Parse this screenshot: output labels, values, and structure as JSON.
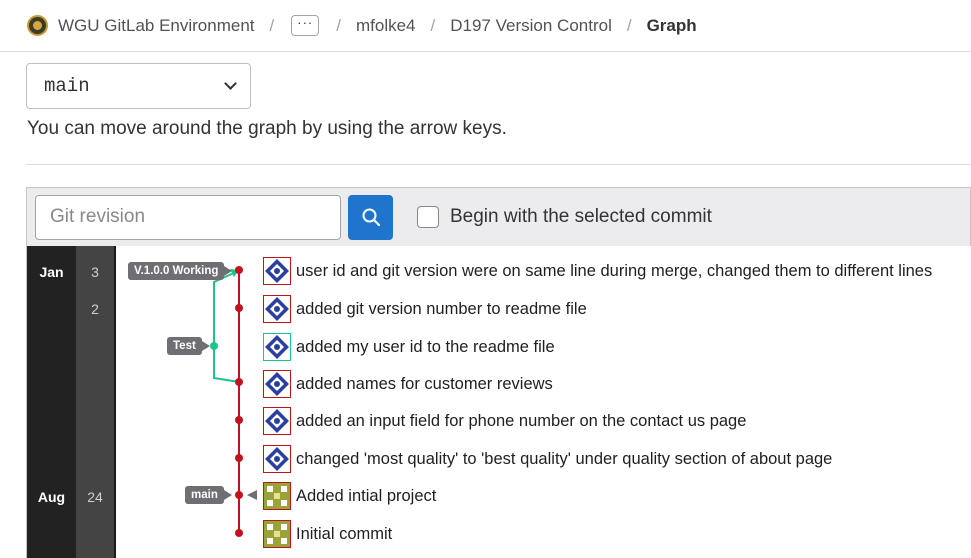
{
  "breadcrumb": {
    "group": "WGU GitLab Environment",
    "ellipsis": "···",
    "user": "mfolke4",
    "project": "D197 Version Control",
    "current": "Graph"
  },
  "branch_select": {
    "value": "main"
  },
  "hint": "You can move around the graph by using the arrow keys.",
  "toolbar": {
    "revision_placeholder": "Git revision",
    "search_icon": "search-icon",
    "checkbox_label": "Begin with the selected commit"
  },
  "graph": {
    "colors": {
      "main_branch": "#c0141c",
      "side_branch": "#1cc48c",
      "month_col": "#222222",
      "day_col": "#444444"
    },
    "months": [
      "Jan",
      "Aug"
    ],
    "days": [
      "3",
      "2",
      "24"
    ],
    "refs": [
      "V.1.0.0 Working",
      "Test",
      "main"
    ],
    "commits": [
      {
        "message": "user id and git version were on same line during merge, changed them to different lines",
        "avatar": "identicon-blue"
      },
      {
        "message": "added git version number to readme file",
        "avatar": "identicon-blue"
      },
      {
        "message": "added my user id to the readme file",
        "avatar": "identicon-teal"
      },
      {
        "message": "added names for customer reviews",
        "avatar": "identicon-blue"
      },
      {
        "message": "added an input field for phone number on the contact us page",
        "avatar": "identicon-blue"
      },
      {
        "message": "changed 'most quality' to 'best quality' under quality section of about page",
        "avatar": "identicon-blue"
      },
      {
        "message": "Added intial project",
        "avatar": "identicon-olive"
      },
      {
        "message": "Initial commit",
        "avatar": "identicon-olive"
      }
    ]
  }
}
